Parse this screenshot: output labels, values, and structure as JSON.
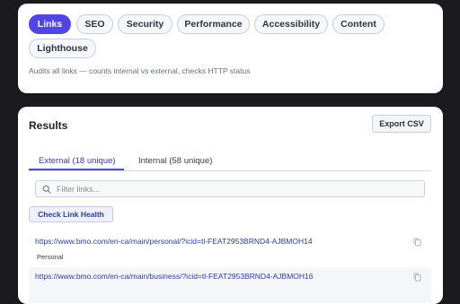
{
  "modes": [
    {
      "label": "Links",
      "active": true
    },
    {
      "label": "SEO",
      "active": false
    },
    {
      "label": "Security",
      "active": false
    },
    {
      "label": "Performance",
      "active": false
    },
    {
      "label": "Accessibility",
      "active": false
    },
    {
      "label": "Content",
      "active": false
    },
    {
      "label": "Lighthouse",
      "active": false
    }
  ],
  "mode_description": "Audits all links — counts internal vs external, checks HTTP status",
  "results": {
    "title": "Results",
    "export_label": "Export CSV",
    "tabs": [
      {
        "label": "External (18 unique)",
        "active": true
      },
      {
        "label": "Internal (58 unique)",
        "active": false
      }
    ],
    "filter_placeholder": "Filter links...",
    "check_button": "Check Link Health",
    "links": [
      {
        "url": "https://www.bmo.com/en-ca/main/personal/?icid=tl-FEAT2953BRND4-AJBMOH14",
        "text": "Personal"
      },
      {
        "url": "https://www.bmo.com/en-ca/main/business/?icid=tl-FEAT2953BRND4-AJBMOH16",
        "text": ""
      }
    ]
  },
  "colors": {
    "accent": "#5046e5",
    "link": "#2c3da3",
    "background": "#1b1b1f",
    "card": "#ffffff"
  },
  "icons": [
    "search-icon",
    "copy-icon"
  ]
}
